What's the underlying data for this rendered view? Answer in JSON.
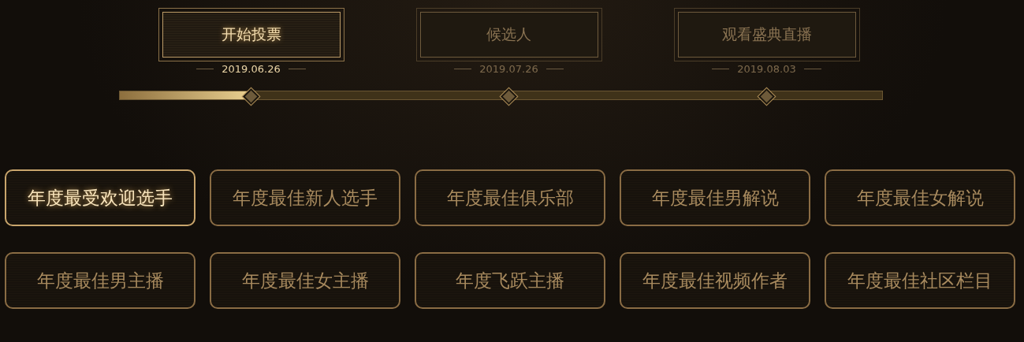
{
  "stages": [
    {
      "label": "开始投票",
      "date": "2019.06.26",
      "selected": true
    },
    {
      "label": "候选人",
      "date": "2019.07.26",
      "selected": false
    },
    {
      "label": "观看盛典直播",
      "date": "2019.08.03",
      "selected": false
    }
  ],
  "progress": {
    "level": 0.17
  },
  "awards": [
    {
      "label": "年度最受欢迎选手",
      "selected": true
    },
    {
      "label": "年度最佳新人选手",
      "selected": false
    },
    {
      "label": "年度最佳俱乐部",
      "selected": false
    },
    {
      "label": "年度最佳男解说",
      "selected": false
    },
    {
      "label": "年度最佳女解说",
      "selected": false
    },
    {
      "label": "年度最佳男主播",
      "selected": false
    },
    {
      "label": "年度最佳女主播",
      "selected": false
    },
    {
      "label": "年度飞跃主播",
      "selected": false
    },
    {
      "label": "年度最佳视频作者",
      "selected": false
    },
    {
      "label": "年度最佳社区栏目",
      "selected": false
    }
  ]
}
